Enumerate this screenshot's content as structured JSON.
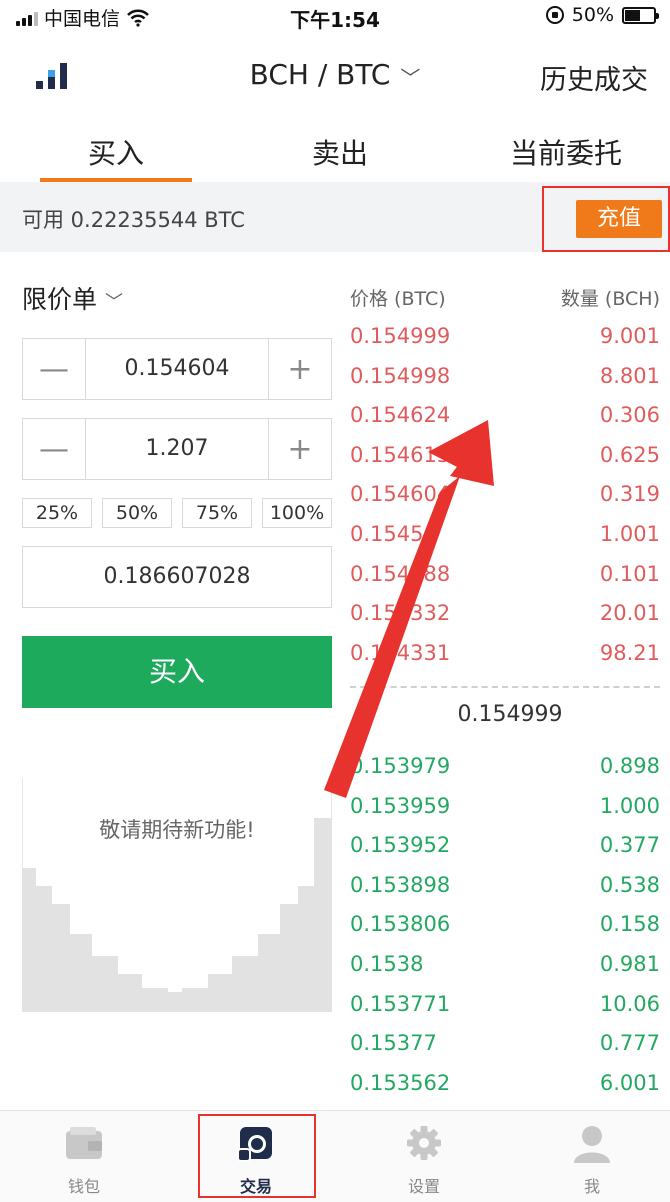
{
  "status_bar": {
    "carrier": "中国电信",
    "time": "下午1:54",
    "battery": "50%"
  },
  "nav": {
    "pair": "BCH / BTC",
    "history": "历史成交"
  },
  "tabs": {
    "buy": "买入",
    "sell": "卖出",
    "orders": "当前委托"
  },
  "account": {
    "available": "可用 0.22235544 BTC",
    "recharge": "充值"
  },
  "form": {
    "order_type": "限价单",
    "price": "0.154604",
    "quantity": "1.207",
    "percents": [
      "25%",
      "50%",
      "75%",
      "100%"
    ],
    "total": "0.186607028",
    "buy_button": "买入",
    "coming_soon": "敬请期待新功能!"
  },
  "order_book": {
    "price_header": "价格 (BTC)",
    "qty_header": "数量 (BCH)",
    "asks": [
      {
        "price": "0.154999",
        "qty": "9.001"
      },
      {
        "price": "0.154998",
        "qty": "8.801"
      },
      {
        "price": "0.154624",
        "qty": "0.306"
      },
      {
        "price": "0.154613",
        "qty": "0.625"
      },
      {
        "price": "0.154604",
        "qty": "0.319"
      },
      {
        "price": "0.1545",
        "qty": "1.001"
      },
      {
        "price": "0.154488",
        "qty": "0.101"
      },
      {
        "price": "0.154332",
        "qty": "20.01"
      },
      {
        "price": "0.154331",
        "qty": "98.21"
      }
    ],
    "last_price": "0.154999",
    "bids": [
      {
        "price": "0.153979",
        "qty": "0.898"
      },
      {
        "price": "0.153959",
        "qty": "1.000"
      },
      {
        "price": "0.153952",
        "qty": "0.377"
      },
      {
        "price": "0.153898",
        "qty": "0.538"
      },
      {
        "price": "0.153806",
        "qty": "0.158"
      },
      {
        "price": "0.1538",
        "qty": "0.981"
      },
      {
        "price": "0.153771",
        "qty": "10.06"
      },
      {
        "price": "0.15377",
        "qty": "0.777"
      },
      {
        "price": "0.153562",
        "qty": "6.001"
      }
    ]
  },
  "tabbar": {
    "wallet": "钱包",
    "trade": "交易",
    "settings": "设置",
    "me": "我"
  },
  "colors": {
    "accent": "#f07a19",
    "buy_green": "#1daa5c",
    "ask_red": "#e05c5c",
    "bid_green": "#23a861",
    "annotation_red": "#e8322e"
  }
}
